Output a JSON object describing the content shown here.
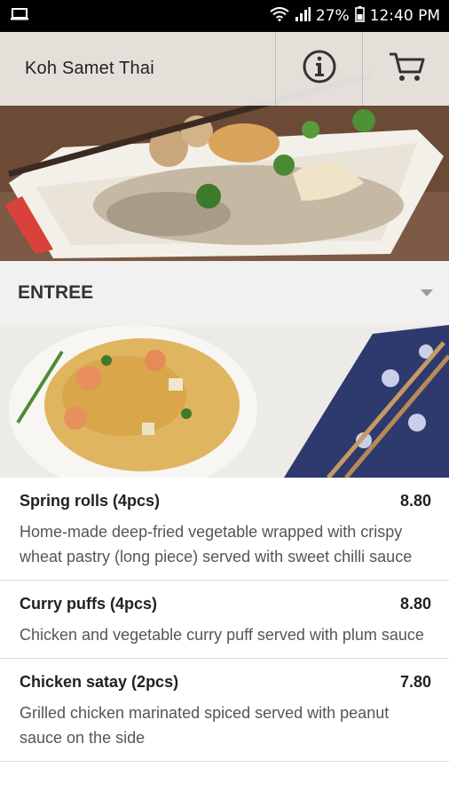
{
  "status_bar": {
    "battery": "27%",
    "time": "12:40 PM"
  },
  "header": {
    "title": "Koh Samet Thai",
    "icons": [
      "info-icon",
      "cart-icon"
    ]
  },
  "section": {
    "label": "ENTREE"
  },
  "menu": {
    "items": [
      {
        "name": "Spring rolls (4pcs)",
        "price": "8.80",
        "description": "Home-made deep-fried vegetable wrapped with crispy wheat pastry (long piece) served with sweet chilli sauce"
      },
      {
        "name": "Curry puffs (4pcs)",
        "price": "8.80",
        "description": "Chicken and vegetable curry puff served with plum sauce"
      },
      {
        "name": "Chicken satay (2pcs)",
        "price": "7.80",
        "description": "Grilled chicken marinated spiced served with peanut sauce on the side"
      }
    ]
  }
}
